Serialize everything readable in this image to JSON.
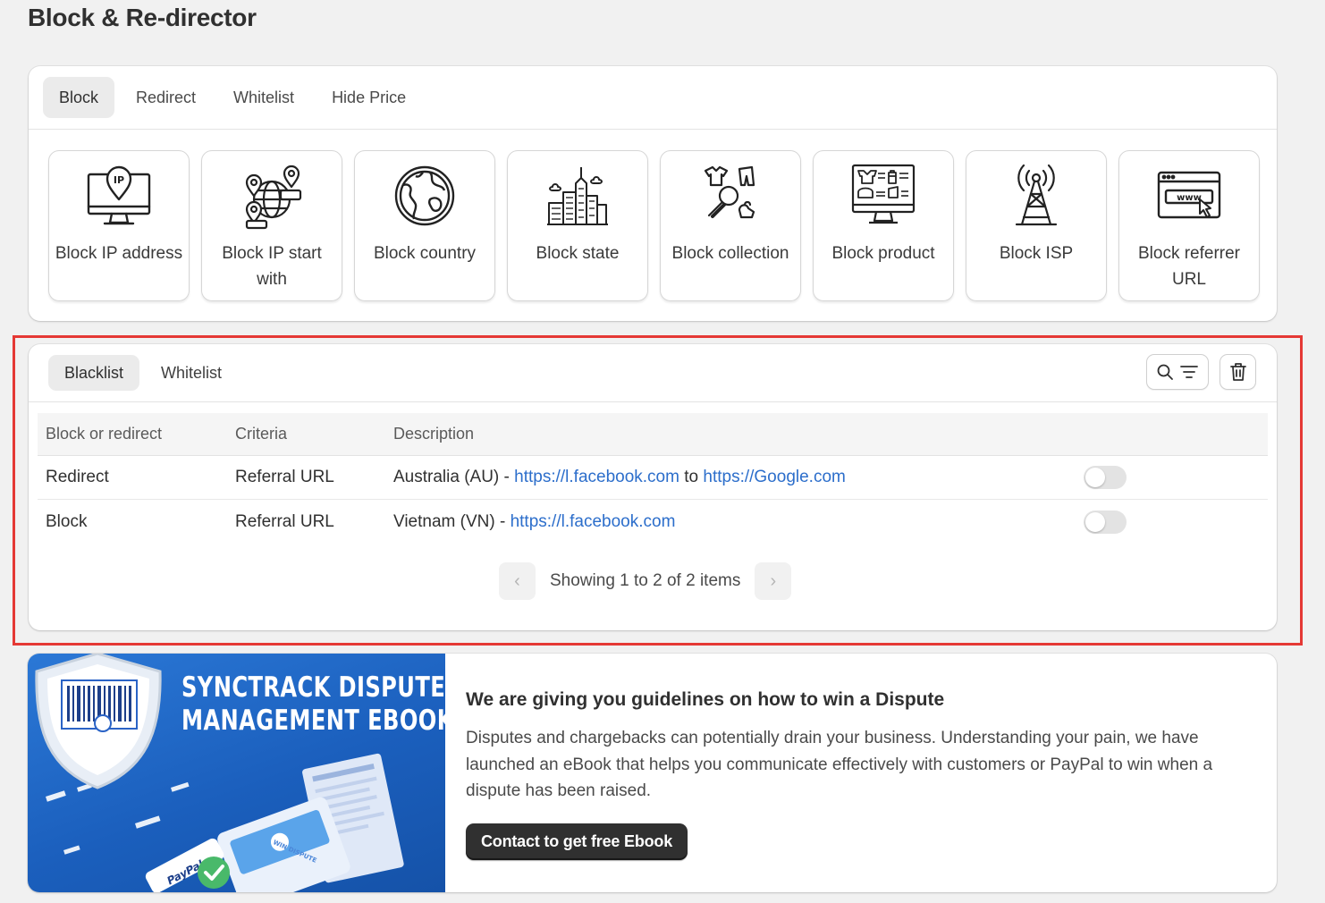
{
  "page": {
    "title": "Block & Re-director"
  },
  "main_tabs": [
    {
      "label": "Block",
      "active": true
    },
    {
      "label": "Redirect",
      "active": false
    },
    {
      "label": "Whitelist",
      "active": false
    },
    {
      "label": "Hide Price",
      "active": false
    }
  ],
  "features": [
    {
      "label": "Block IP address",
      "icon": "monitor-ip-icon"
    },
    {
      "label": "Block IP start with",
      "icon": "globe-pins-icon"
    },
    {
      "label": "Block country",
      "icon": "globe-icon"
    },
    {
      "label": "Block state",
      "icon": "city-buildings-icon"
    },
    {
      "label": "Block collection",
      "icon": "collection-search-icon"
    },
    {
      "label": "Block product",
      "icon": "product-monitor-icon"
    },
    {
      "label": "Block ISP",
      "icon": "antenna-tower-icon"
    },
    {
      "label": "Block referrer URL",
      "icon": "browser-www-icon"
    }
  ],
  "list": {
    "tabs": [
      {
        "label": "Blacklist",
        "active": true
      },
      {
        "label": "Whitelist",
        "active": false
      }
    ],
    "columns": [
      "Block or redirect",
      "Criteria",
      "Description"
    ],
    "rows": [
      {
        "type": "Redirect",
        "criteria": "Referral URL",
        "desc_prefix": "Australia (AU) - ",
        "link1": "https://l.facebook.com",
        "desc_mid": " to ",
        "link2": "https://Google.com",
        "enabled": false
      },
      {
        "type": "Block",
        "criteria": "Referral URL",
        "desc_prefix": "Vietnam (VN) - ",
        "link1": "https://l.facebook.com",
        "enabled": false
      }
    ],
    "pagination": {
      "text": "Showing 1 to 2 of 2 items"
    }
  },
  "ebook": {
    "headline_line1": "SYNCTRACK DISPUTE",
    "headline_line2": "MANAGEMENT EBOOK",
    "badge_paypal": "PayPal",
    "badge_dispute": "WIN DISPUTE",
    "title": "We are giving you guidelines on how to win a Dispute",
    "description": "Disputes and chargebacks can potentially drain your business. Understanding your pain, we have launched an eBook that helps you communicate effectively with customers or PayPal to win when a dispute has been raised.",
    "button": "Contact to get free Ebook"
  },
  "colors": {
    "link": "#2c6ecb",
    "highlight": "#e53935",
    "banner": "#1b5fbd"
  }
}
